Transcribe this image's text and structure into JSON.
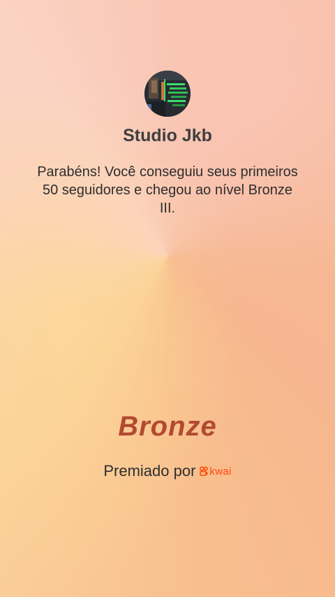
{
  "profile": {
    "avatar_icon": "studio-equalizer-avatar",
    "name": "Studio Jkb"
  },
  "message": {
    "text": "Parabéns! Você conseguiu seus primeiros 50 seguidores e chegou ao nível Bronze III."
  },
  "level": {
    "title": "Bronze",
    "color": "#b24a30"
  },
  "sponsor": {
    "label": "Premiado por",
    "brand": "kwai",
    "brand_color": "#ff4906"
  }
}
